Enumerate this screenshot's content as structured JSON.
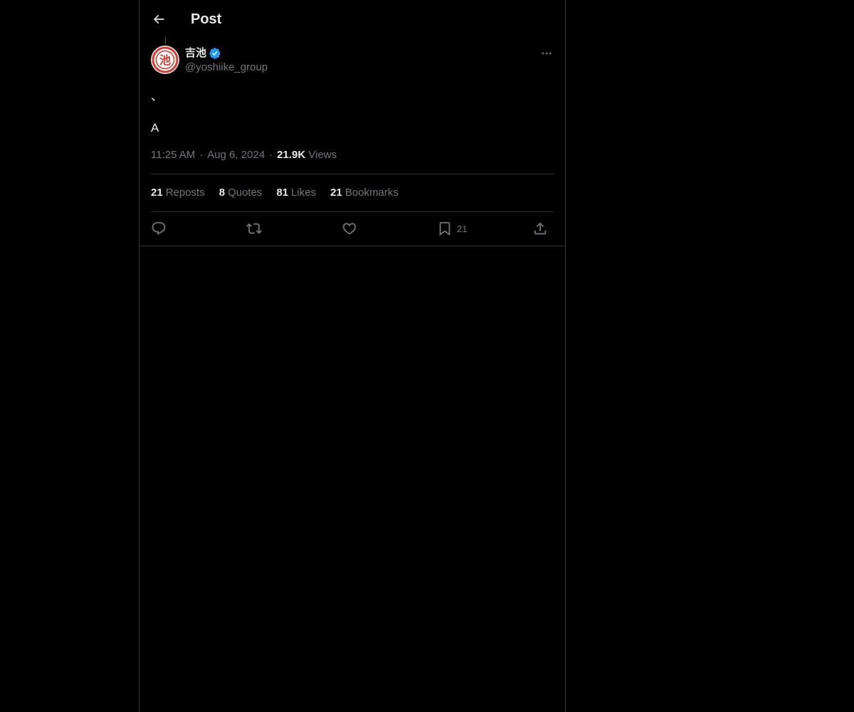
{
  "header": {
    "title": "Post"
  },
  "post": {
    "author": {
      "name": "吉池",
      "handle": "@yoshiike_group",
      "avatar_text": "池"
    },
    "text_line1": "、",
    "text_line2": "A",
    "time": "11:25 AM",
    "date": "Aug 6, 2024",
    "views_count": "21.9K",
    "views_label": "Views",
    "separator": "·",
    "stats": [
      {
        "count": "21",
        "label": "Reposts"
      },
      {
        "count": "8",
        "label": "Quotes"
      },
      {
        "count": "81",
        "label": "Likes"
      },
      {
        "count": "21",
        "label": "Bookmarks"
      }
    ],
    "actions": {
      "bookmark_count": "21"
    }
  },
  "icons": {
    "back": "arrow-left-icon",
    "verified": "verified-badge-icon",
    "more": "more-horizontal-icon",
    "reply": "reply-icon",
    "repost": "repost-icon",
    "like": "heart-icon",
    "bookmark": "bookmark-icon",
    "share": "share-icon"
  },
  "colors": {
    "background": "#000000",
    "text_primary": "#e7e9ea",
    "text_secondary": "#71767b",
    "border": "#2f3336",
    "verified_blue": "#1d9bf0",
    "avatar_red": "#d9382e"
  }
}
